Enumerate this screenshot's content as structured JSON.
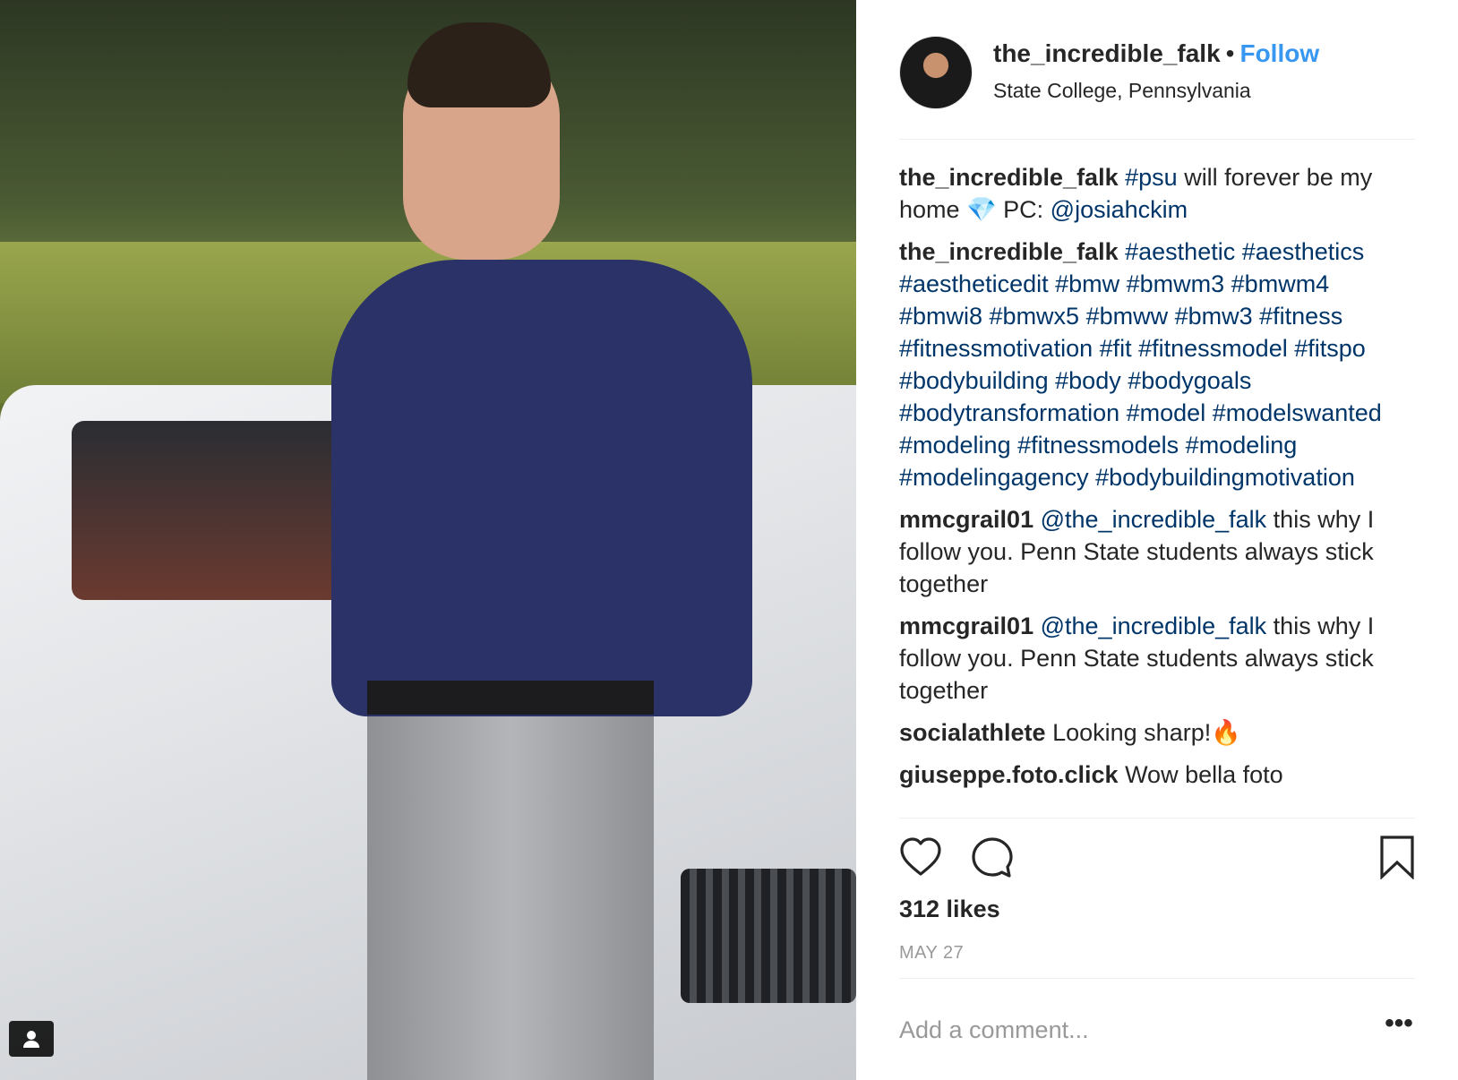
{
  "post": {
    "username": "the_incredible_falk",
    "dot": "•",
    "follow_label": "Follow",
    "location": "State College, Pennsylvania"
  },
  "comments": [
    {
      "user": "the_incredible_falk",
      "parts": [
        {
          "kind": "tag",
          "text": "#psu"
        },
        {
          "kind": "text",
          "text": " will forever be my home 💎 PC: "
        },
        {
          "kind": "tag",
          "text": "@josiahckim"
        }
      ]
    },
    {
      "user": "the_incredible_falk",
      "parts": [
        {
          "kind": "tag",
          "text": "#aesthetic #aesthetics #aestheticedit #bmw #bmwm3 #bmwm4 #bmwi8 #bmwx5 #bmww #bmw3 #fitness #fitnessmotivation #fit #fitnessmodel #fitspo #bodybuilding #body #bodygoals #bodytransformation #model #modelswanted #modeling #fitnessmodels #modeling #modelingagency #bodybuildingmotivation"
        }
      ]
    },
    {
      "user": "mmcgrail01",
      "parts": [
        {
          "kind": "tag",
          "text": "@the_incredible_falk"
        },
        {
          "kind": "text",
          "text": " this why I follow you. Penn State students always stick together"
        }
      ]
    },
    {
      "user": "mmcgrail01",
      "parts": [
        {
          "kind": "tag",
          "text": "@the_incredible_falk"
        },
        {
          "kind": "text",
          "text": " this why I follow you. Penn State students always stick together"
        }
      ]
    },
    {
      "user": "socialathlete",
      "parts": [
        {
          "kind": "text",
          "text": "Looking sharp!🔥"
        }
      ]
    },
    {
      "user": "giuseppe.foto.click",
      "parts": [
        {
          "kind": "text",
          "text": "Wow bella foto"
        }
      ]
    }
  ],
  "stats": {
    "likes": "312 likes",
    "date": "MAY 27"
  },
  "comment_box": {
    "placeholder": "Add a comment...",
    "more_label": "•••"
  },
  "colors": {
    "link": "#003569",
    "follow": "#3897f0",
    "muted": "#999999",
    "text": "#262626"
  },
  "icons": {
    "like": "heart-icon",
    "comment": "comment-icon",
    "save": "bookmark-icon",
    "photo_tag": "user-tag-icon"
  }
}
